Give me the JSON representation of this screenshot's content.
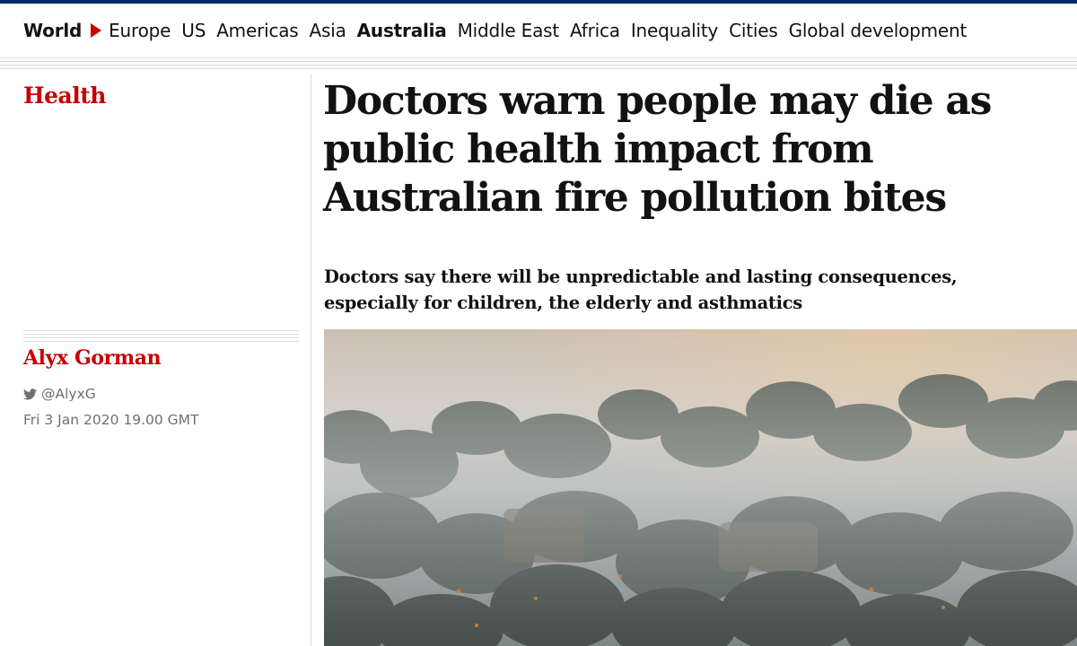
{
  "nav": {
    "items": [
      {
        "label": "World",
        "bold": true
      },
      {
        "label": "Europe"
      },
      {
        "label": "US"
      },
      {
        "label": "Americas"
      },
      {
        "label": "Asia"
      },
      {
        "label": "Australia",
        "bold": true
      },
      {
        "label": "Middle East"
      },
      {
        "label": "Africa"
      },
      {
        "label": "Inequality"
      },
      {
        "label": "Cities"
      },
      {
        "label": "Global development"
      }
    ]
  },
  "article": {
    "section": "Health",
    "headline": "Doctors warn people may die as public health impact from Australian fire pollution bites",
    "standfirst": "Doctors say there will be unpredictable and lasting consequences, especially for children, the elderly and asthmatics",
    "author": "Alyx Gorman",
    "twitter_handle": "@AlyxG",
    "date": "Fri 3 Jan 2020 19.00 GMT",
    "image_icon": "bushfire-smoke-photo"
  },
  "colors": {
    "brand_blue": "#052962",
    "accent_red": "#c70000",
    "text": "#121212",
    "muted": "#707070",
    "rule": "#dcdcdc"
  }
}
